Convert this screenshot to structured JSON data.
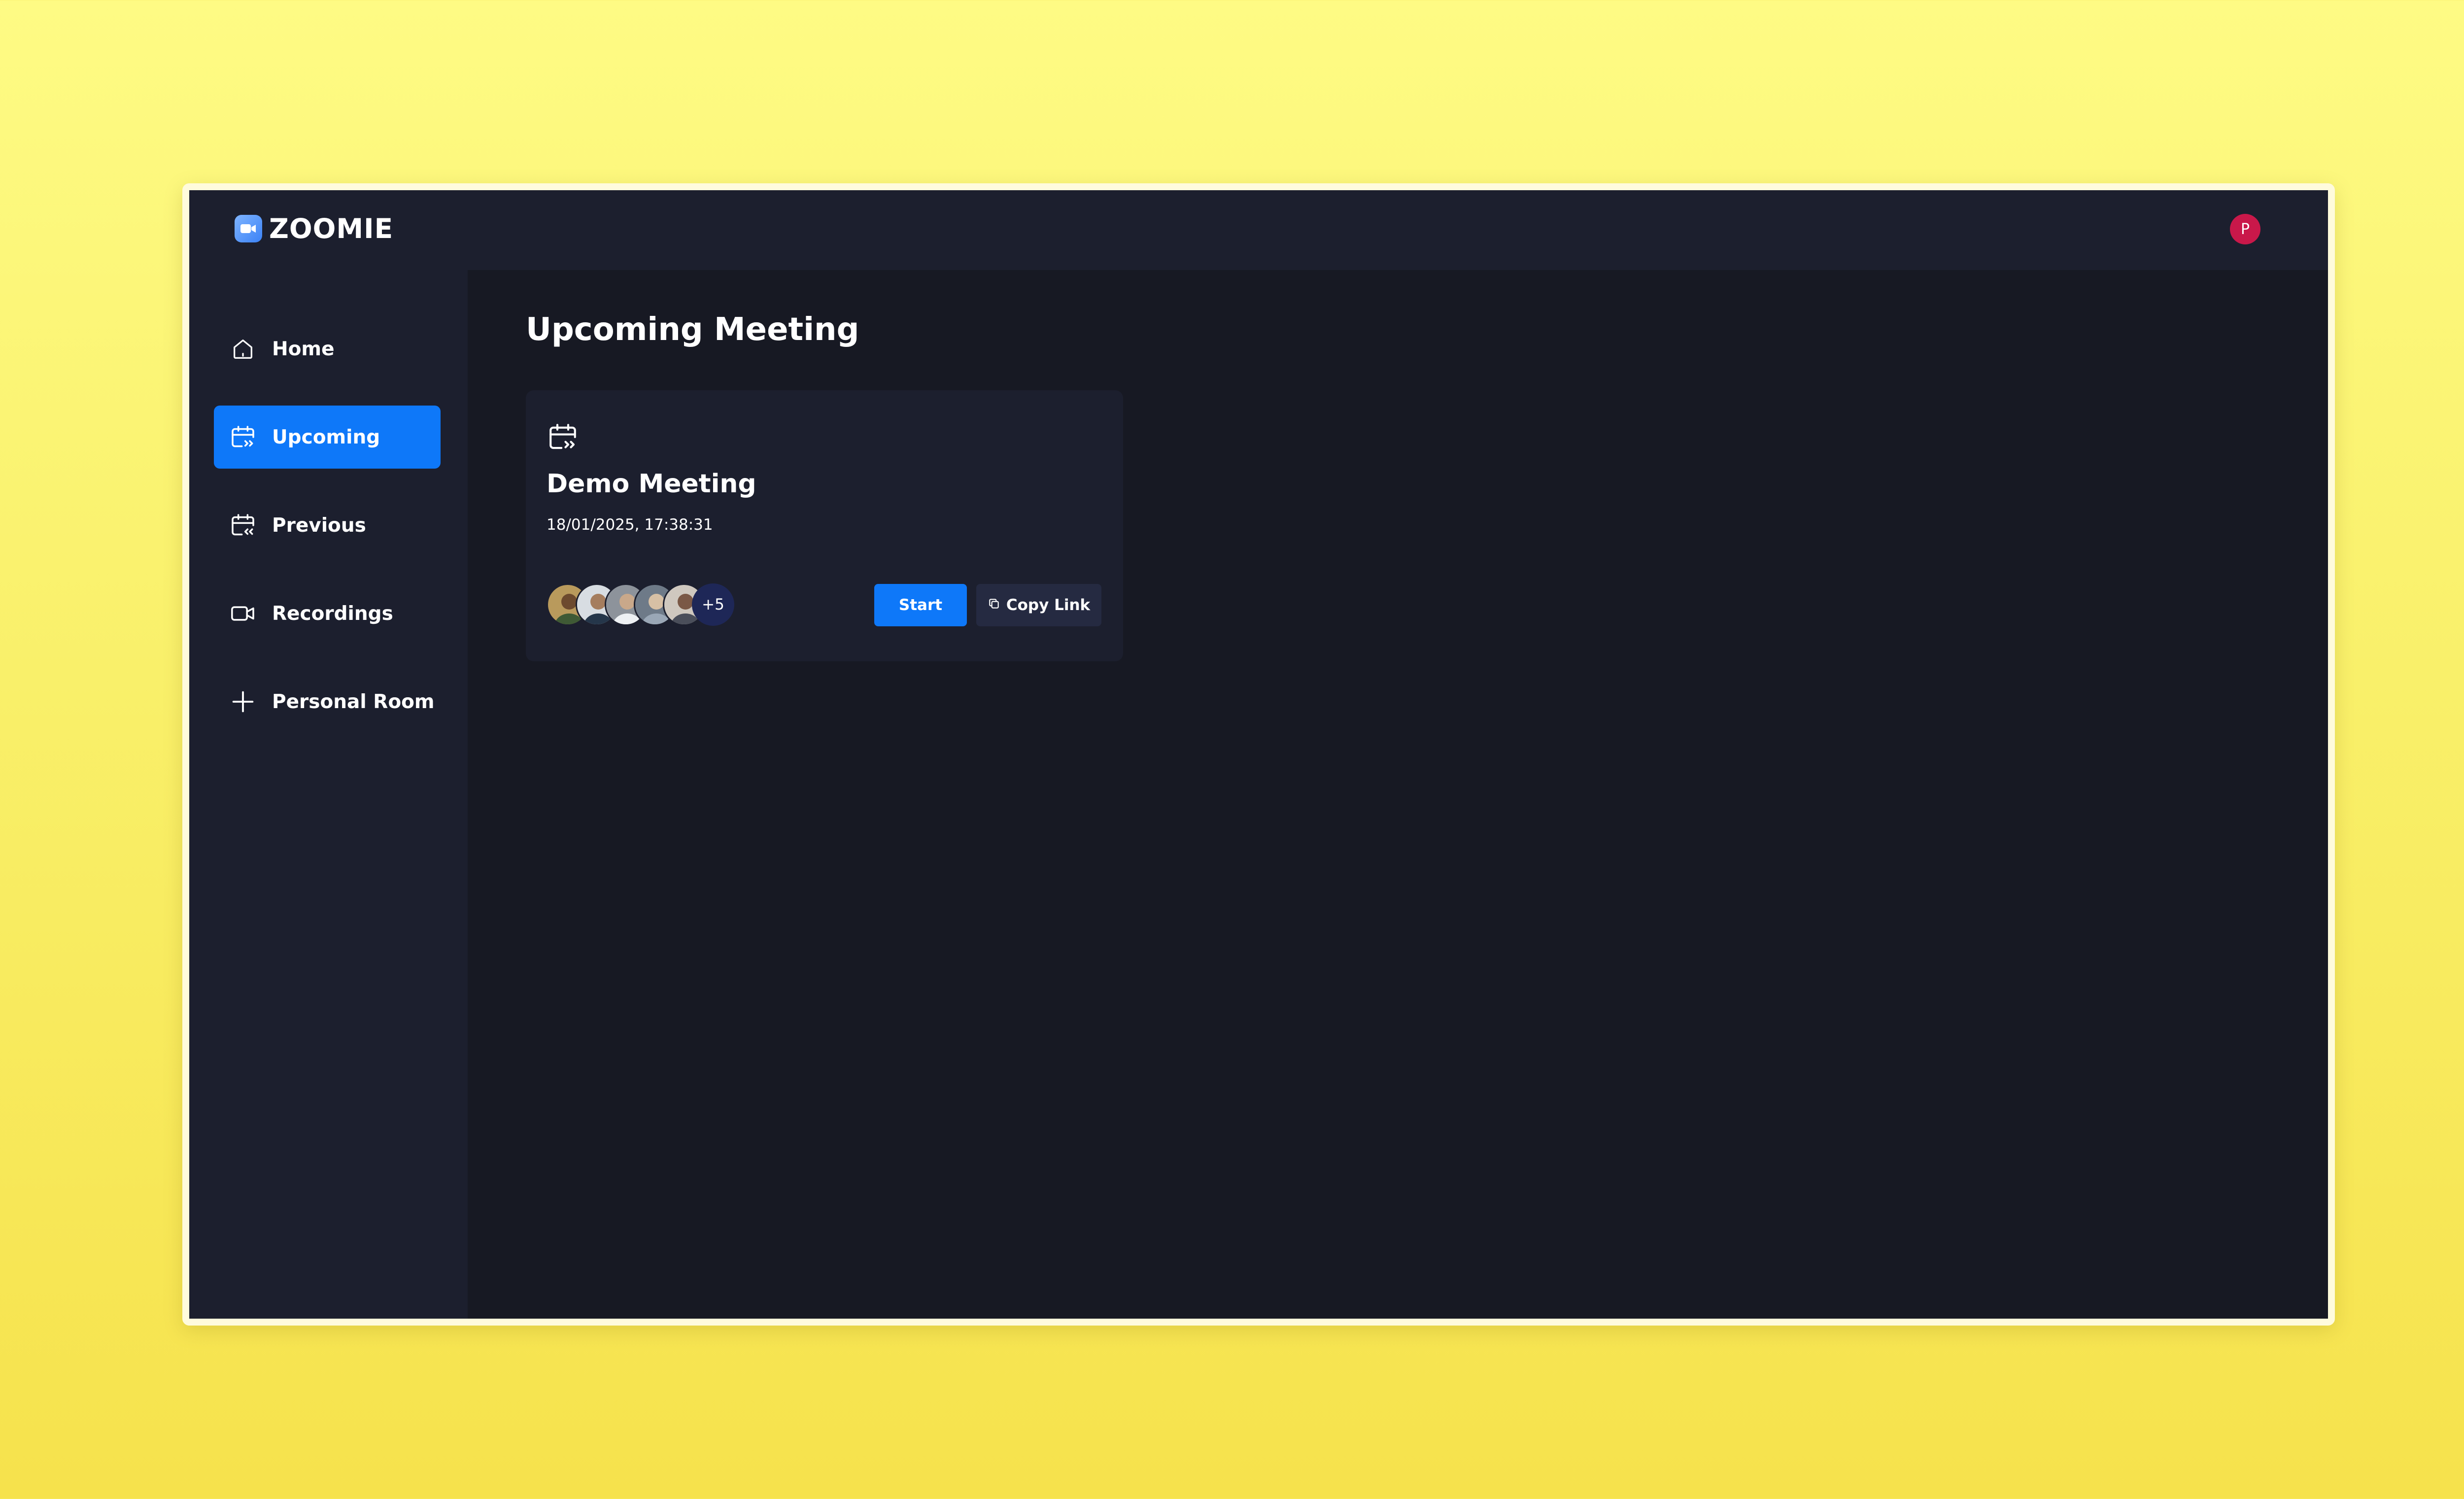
{
  "app": {
    "name": "ZOOMIE",
    "user_initial": "P"
  },
  "sidebar": {
    "items": [
      {
        "label": "Home",
        "icon": "home-icon",
        "active": false
      },
      {
        "label": "Upcoming",
        "icon": "calendar-upcoming-icon",
        "active": true
      },
      {
        "label": "Previous",
        "icon": "calendar-previous-icon",
        "active": false
      },
      {
        "label": "Recordings",
        "icon": "video-icon",
        "active": false
      },
      {
        "label": "Personal Room",
        "icon": "plus-icon",
        "active": false
      }
    ]
  },
  "main": {
    "title": "Upcoming Meeting",
    "meeting": {
      "title": "Demo Meeting",
      "datetime": "18/01/2025, 17:38:31",
      "icon": "calendar-upcoming-icon",
      "attendees_extra": "+5",
      "start_label": "Start",
      "copy_label": "Copy Link"
    }
  },
  "colors": {
    "accent": "#0e78f9",
    "sidebar_bg": "#1c1f2e",
    "main_bg": "#171923",
    "avatar": "#c9184a"
  }
}
